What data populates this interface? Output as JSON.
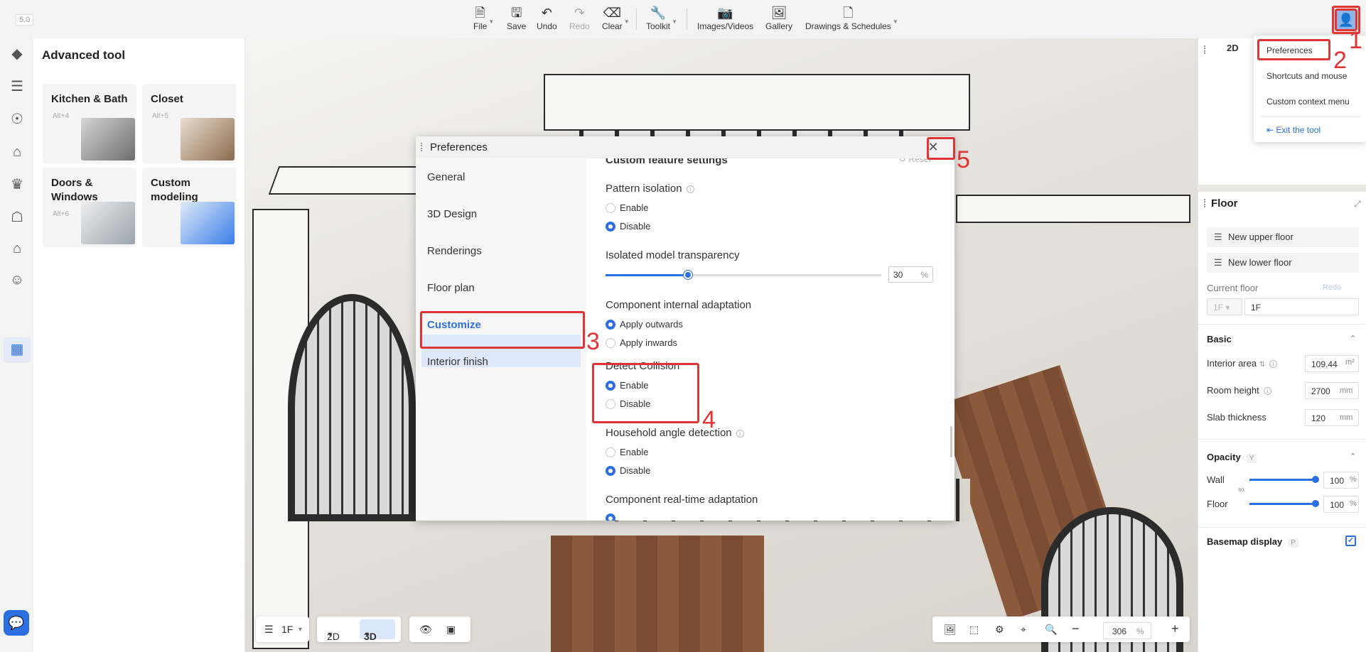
{
  "version": "5.0",
  "toolbar": {
    "items": [
      {
        "label": "File",
        "icon": "file-icon"
      },
      {
        "label": "Save",
        "icon": "save-icon"
      },
      {
        "label": "Undo",
        "icon": "undo-icon"
      },
      {
        "label": "Redo",
        "icon": "redo-icon",
        "disabled": true
      },
      {
        "label": "Clear",
        "icon": "eraser-icon"
      },
      {
        "label": "Toolkit",
        "icon": "wrench-icon"
      },
      {
        "label": "Images/Videos",
        "icon": "camera-icon"
      },
      {
        "label": "Gallery",
        "icon": "gallery-icon"
      },
      {
        "label": "Drawings & Schedules",
        "icon": "document-icon"
      }
    ]
  },
  "user_menu": {
    "items": [
      "Preferences",
      "Shortcuts and mouse",
      "Custom context menu"
    ],
    "exit": "Exit the tool"
  },
  "advanced_tool": {
    "title": "Advanced tool",
    "cards": [
      {
        "title": "Kitchen & Bath",
        "shortcut": "Alt+4"
      },
      {
        "title": "Closet",
        "shortcut": "Alt+5"
      },
      {
        "title": "Doors & Windows",
        "shortcut": "Alt+6"
      },
      {
        "title": "Custom modeling",
        "shortcut": ""
      }
    ]
  },
  "preferences": {
    "title": "Preferences",
    "nav": [
      "General",
      "3D Design",
      "Renderings",
      "Floor plan",
      "Customize",
      "Interior finish"
    ],
    "active_nav": "Customize",
    "section_title": "Custom feature settings",
    "reset": "Reset",
    "pattern_isolation": {
      "label": "Pattern isolation",
      "options": [
        "Enable",
        "Disable"
      ],
      "selected": "Disable"
    },
    "isolated_transparency": {
      "label": "Isolated model transparency",
      "value": "30",
      "unit": "%",
      "fraction": 0.3
    },
    "component_adaptation": {
      "label": "Component internal adaptation",
      "options": [
        "Apply outwards",
        "Apply inwards"
      ],
      "selected": "Apply outwards"
    },
    "detect_collision": {
      "label": "Detect Collision",
      "options": [
        "Enable",
        "Disable"
      ],
      "selected": "Enable"
    },
    "household_angle": {
      "label": "Household angle detection",
      "options": [
        "Enable",
        "Disable"
      ],
      "selected": "Disable"
    },
    "realtime_adaptation": {
      "label": "Component real-time adaptation"
    }
  },
  "minimap": {
    "tab": "2D"
  },
  "floor_panel": {
    "title": "Floor",
    "new_upper": "New upper floor",
    "new_lower": "New lower floor",
    "current_floor_label": "Current floor",
    "redo": "Redo",
    "floor_select": "1F",
    "floor_name": "1F",
    "basic": "Basic",
    "interior_area_label": "Interior area",
    "interior_area": "109.44",
    "interior_area_unit": "m²",
    "room_height_label": "Room height",
    "room_height": "2700",
    "room_height_unit": "mm",
    "slab_label": "Slab thickness",
    "slab": "120",
    "slab_unit": "mm",
    "opacity": "Opacity",
    "opacity_key": "Y",
    "wall_label": "Wall",
    "wall_value": "100",
    "floor_label": "Floor",
    "floor_value": "100",
    "percent": "%",
    "basemap": "Basemap display",
    "basemap_key": "P"
  },
  "bottom": {
    "floor": "1F",
    "view2d": "2D",
    "view3d": "3D",
    "zoom": "306",
    "zoom_unit": "%"
  },
  "annotations": [
    "1",
    "2",
    "3",
    "4",
    "5"
  ],
  "colors": {
    "accent": "#2b6fe0",
    "highlight": "#e03535"
  }
}
